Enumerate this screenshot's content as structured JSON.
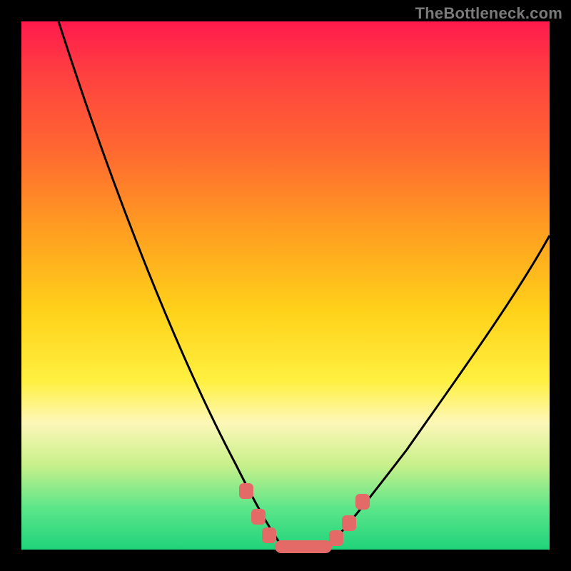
{
  "watermark": "TheBottleneck.com",
  "colors": {
    "background": "#000000",
    "gradient_top": "#ff1a4d",
    "gradient_bottom": "#1fd37a",
    "curve": "#000000",
    "marker": "#e36a66",
    "watermark": "#7a7a7a"
  },
  "chart_data": {
    "type": "line",
    "title": "",
    "xlabel": "",
    "ylabel": "",
    "xlim": [
      0,
      100
    ],
    "ylim": [
      0,
      100
    ],
    "grid": false,
    "legend": false,
    "annotations": [
      "TheBottleneck.com"
    ],
    "series": [
      {
        "name": "left-branch",
        "x": [
          7,
          12,
          18,
          24,
          30,
          35,
          40,
          44,
          47,
          49
        ],
        "y": [
          100,
          86,
          71,
          55,
          40,
          28,
          16,
          8,
          3,
          0
        ]
      },
      {
        "name": "valley-floor",
        "x": [
          49,
          58
        ],
        "y": [
          0,
          0
        ]
      },
      {
        "name": "right-branch",
        "x": [
          58,
          62,
          67,
          73,
          80,
          88,
          96,
          100
        ],
        "y": [
          0,
          3,
          8,
          16,
          27,
          40,
          53,
          60
        ]
      }
    ],
    "markers": [
      {
        "x": 42.5,
        "y": 11,
        "shape": "rounded-square"
      },
      {
        "x": 44.8,
        "y": 6,
        "shape": "rounded-square"
      },
      {
        "x": 46.8,
        "y": 2.5,
        "shape": "rounded-square"
      },
      {
        "x": 53.0,
        "y": 0,
        "shape": "rounded-bar-wide"
      },
      {
        "x": 59.5,
        "y": 2,
        "shape": "rounded-square"
      },
      {
        "x": 62.0,
        "y": 5,
        "shape": "rounded-square"
      },
      {
        "x": 64.5,
        "y": 9,
        "shape": "rounded-square"
      }
    ]
  }
}
